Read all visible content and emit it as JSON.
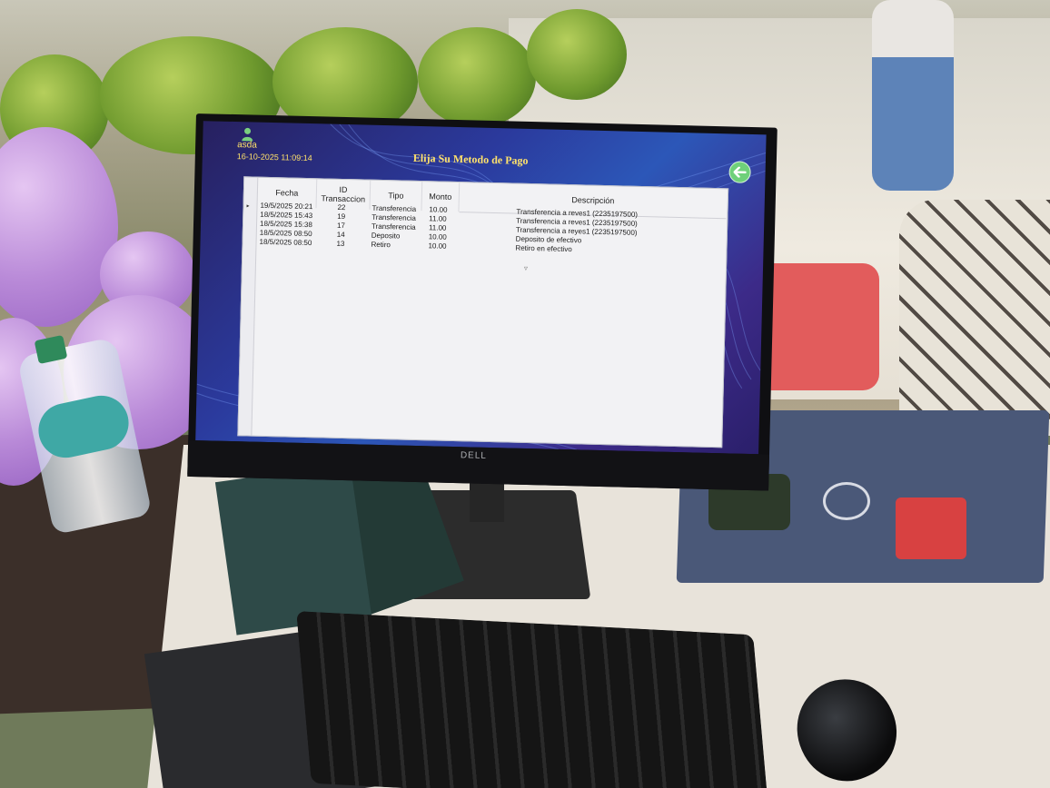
{
  "app": {
    "user_name": "asda",
    "datetime": "16-10-2025 11:09:14",
    "title": "Elija Su Metodo de Pago",
    "back_icon": "back-arrow-icon"
  },
  "table": {
    "columns": [
      "Fecha",
      "ID Transaccion",
      "Tipo",
      "Monto",
      "Descripción"
    ],
    "rows": [
      {
        "fecha": "19/5/2025 20:21",
        "id": "22",
        "tipo": "Transferencia",
        "monto": "10.00",
        "descripcion": "Transferencia a reves1 (2235197500)"
      },
      {
        "fecha": "18/5/2025 15:43",
        "id": "19",
        "tipo": "Transferencia",
        "monto": "11.00",
        "descripcion": "Transferencia a reves1 (2235197500)"
      },
      {
        "fecha": "18/5/2025 15:38",
        "id": "17",
        "tipo": "Transferencia",
        "monto": "11.00",
        "descripcion": "Transferencia a reyes1 (2235197500)"
      },
      {
        "fecha": "18/5/2025 08:50",
        "id": "14",
        "tipo": "Deposito",
        "monto": "10.00",
        "descripcion": "Deposito de efectivo"
      },
      {
        "fecha": "18/5/2025 08:50",
        "id": "13",
        "tipo": "Retiro",
        "monto": "10.00",
        "descripcion": "Retiro en efectivo"
      }
    ]
  },
  "monitor": {
    "brand": "DELL"
  },
  "colors": {
    "header_text": "#ffe26b",
    "back_button": "#6fd07a",
    "grid_bg": "#f2f2f4"
  }
}
